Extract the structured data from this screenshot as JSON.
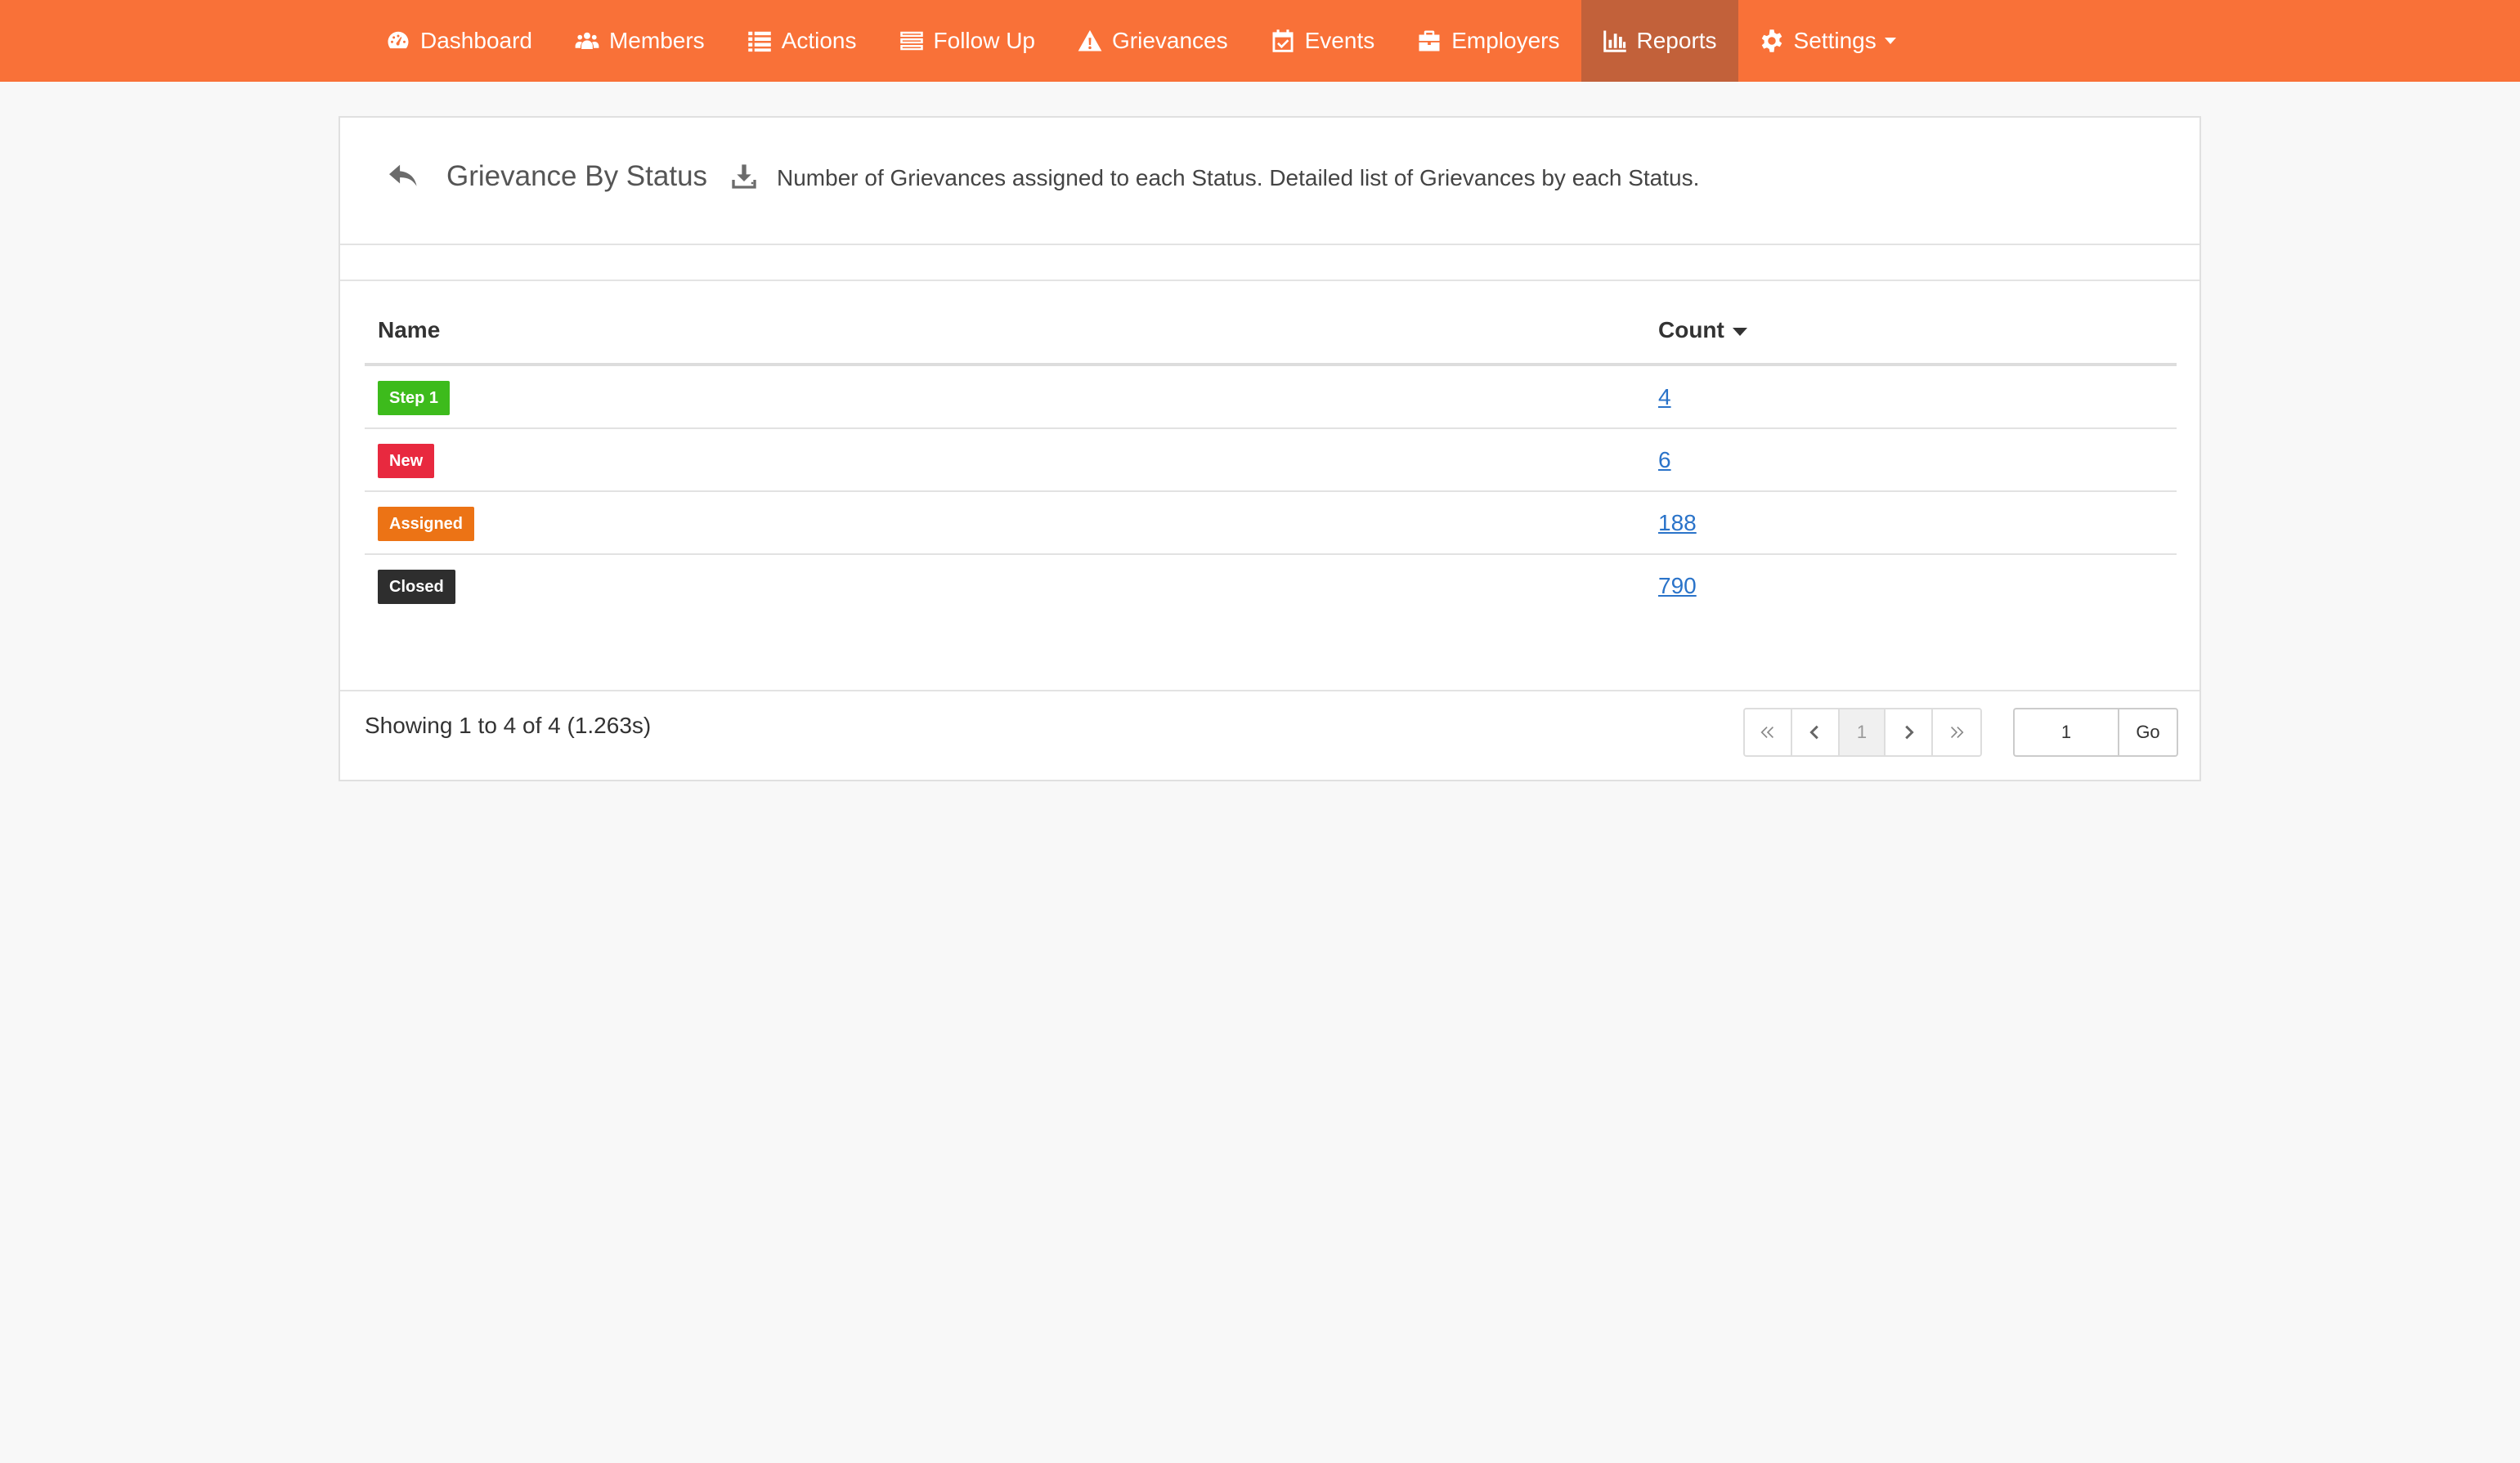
{
  "nav": {
    "items": [
      {
        "label": "Dashboard",
        "icon": "dashboard-icon",
        "active": false
      },
      {
        "label": "Members",
        "icon": "users-icon",
        "active": false
      },
      {
        "label": "Actions",
        "icon": "list-icon",
        "active": false
      },
      {
        "label": "Follow Up",
        "icon": "tasks-icon",
        "active": false
      },
      {
        "label": "Grievances",
        "icon": "warning-icon",
        "active": false
      },
      {
        "label": "Events",
        "icon": "calendar-check-icon",
        "active": false
      },
      {
        "label": "Employers",
        "icon": "briefcase-icon",
        "active": false
      },
      {
        "label": "Reports",
        "icon": "bar-chart-icon",
        "active": true
      },
      {
        "label": "Settings",
        "icon": "gear-icon",
        "active": false
      }
    ],
    "background": "#f97138",
    "active_background": "#c2613a"
  },
  "panel": {
    "title": "Grievance By Status",
    "description": "Number of Grievances assigned to each Status. Detailed list of Grievances by each Status."
  },
  "table": {
    "columns": {
      "name": "Name",
      "count": "Count"
    },
    "rows": [
      {
        "name": "Step 1",
        "count": "4",
        "color": "#3dbb1c"
      },
      {
        "name": "New",
        "count": "6",
        "color": "#e8293f"
      },
      {
        "name": "Assigned",
        "count": "188",
        "color": "#ec7315"
      },
      {
        "name": "Closed",
        "count": "790",
        "color": "#2e2e2e"
      }
    ]
  },
  "footer": {
    "showing": "Showing 1 to 4 of 4 (1.263s)",
    "current_page": "1",
    "goto_value": "1",
    "go_label": "Go"
  }
}
